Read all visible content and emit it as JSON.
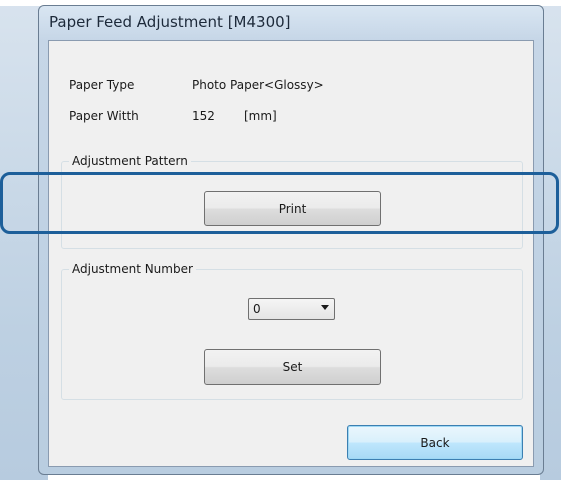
{
  "window": {
    "title": "Paper Feed Adjustment [M4300]"
  },
  "info": {
    "paper_type_label": "Paper Type",
    "paper_type_value": "Photo Paper<Glossy>",
    "paper_width_label": "Paper Witth",
    "paper_width_value": "152",
    "paper_width_unit": "[mm]"
  },
  "adjustment_pattern": {
    "group_title": "Adjustment Pattern",
    "print_label": "Print"
  },
  "adjustment_number": {
    "group_title": "Adjustment Number",
    "selected_value": "0",
    "set_label": "Set"
  },
  "footer": {
    "back_label": "Back"
  },
  "colors": {
    "highlight": "#1d5f9a",
    "default_button_border": "#3c7fb1"
  }
}
